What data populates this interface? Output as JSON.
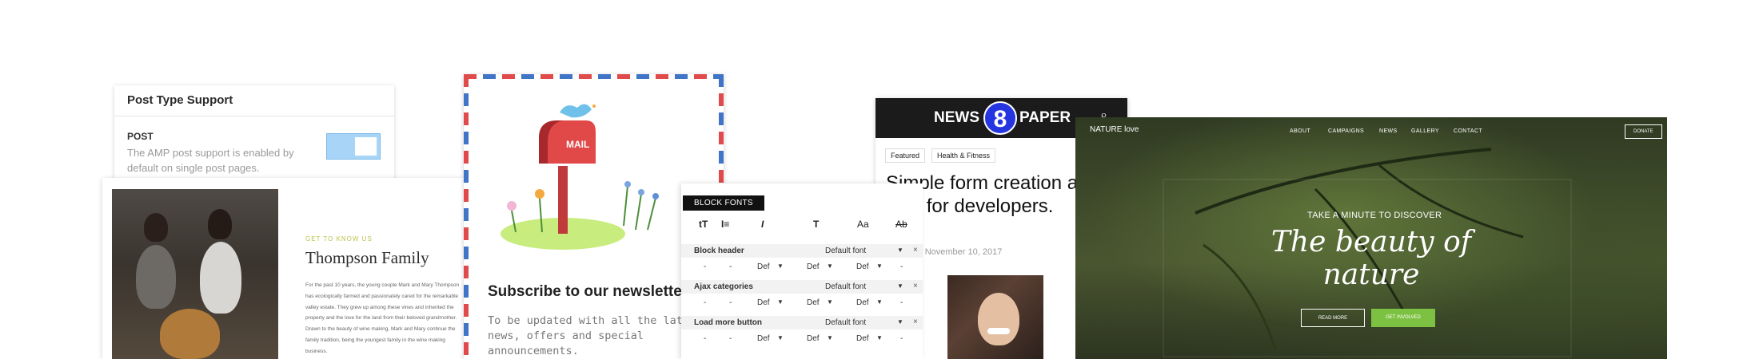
{
  "post_type_support": {
    "title": "Post Type Support",
    "label": "POST",
    "description": "The AMP post support is enabled by default on single post pages."
  },
  "thompson": {
    "kicker": "GET TO KNOW US",
    "title": "Thompson Family",
    "body": "For the past 10 years, the young couple Mark and Mary Thompson has ecologically farmed and passionately cared for the remarkable valley estate. They grew up among these vines and inherited the property and the love for the land from their beloved grandmother. Drawn to the beauty of wine making, Mark and Mary continue the family tradition, being the youngest family in the wine making business."
  },
  "newsletter": {
    "mailbox_label": "MAIL",
    "title": "Subscribe to our newsletter",
    "body": "To be updated with all the latest news, offers and special announcements."
  },
  "block_fonts": {
    "tab": "BLOCK FONTS",
    "icons": [
      "tT",
      "I≡",
      "I",
      "T",
      "Aa",
      "Ab"
    ],
    "sections": [
      {
        "name": "Block header",
        "value": "Default font"
      },
      {
        "name": "Ajax categories",
        "value": "Default font"
      },
      {
        "name": "Load more button",
        "value": "Default font"
      }
    ],
    "sub": {
      "dash": "-",
      "def": "Def",
      "arrow": "▼",
      "close": "×"
    }
  },
  "newspaper": {
    "brand_left": "NEWS",
    "brand_num": "8",
    "brand_right": "PAPER",
    "tags": [
      "Featured",
      "Health & Fitness"
    ],
    "headline": "Simple form creation a page, built for developers.",
    "date": "- November 10, 2017"
  },
  "nature": {
    "logo": "NATURE love",
    "menu": [
      "ABOUT",
      "CAMPAIGNS",
      "NEWS",
      "GALLERY",
      "CONTACT"
    ],
    "donate": "DONATE",
    "kicker": "TAKE A MINUTE TO DISCOVER",
    "title": "The beauty of nature",
    "read_more": "READ MORE",
    "get_involved": "GET INVOLVED"
  }
}
